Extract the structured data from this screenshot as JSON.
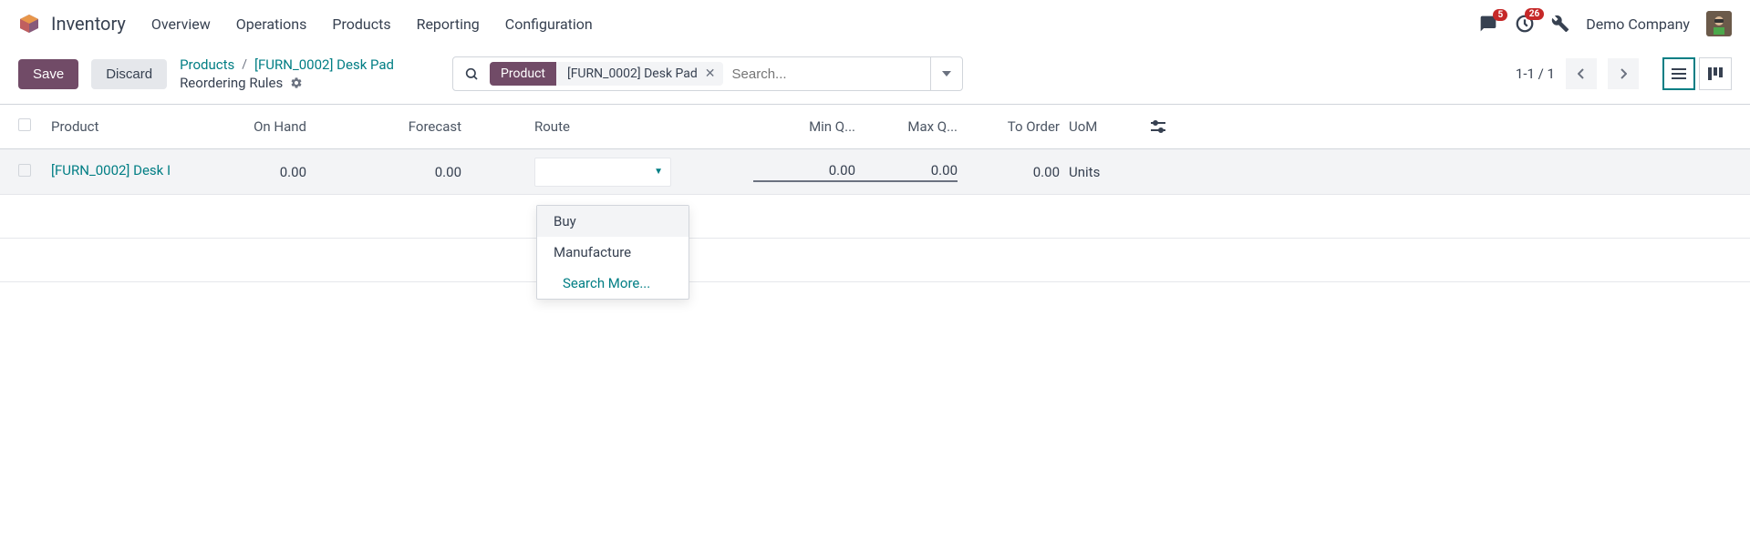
{
  "topnav": {
    "app_title": "Inventory",
    "items": [
      "Overview",
      "Operations",
      "Products",
      "Reporting",
      "Configuration"
    ],
    "msg_badge": "5",
    "activity_badge": "26",
    "company": "Demo Company"
  },
  "controls": {
    "save": "Save",
    "discard": "Discard",
    "breadcrumb": {
      "link1": "Products",
      "link2": "[FURN_0002] Desk Pad",
      "current": "Reordering Rules"
    },
    "search": {
      "tag_label": "Product",
      "tag_value": "[FURN_0002] Desk Pad",
      "placeholder": "Search..."
    },
    "pager": "1-1 / 1"
  },
  "table": {
    "headers": {
      "product": "Product",
      "onhand": "On Hand",
      "forecast": "Forecast",
      "route": "Route",
      "minq": "Min Q...",
      "maxq": "Max Q...",
      "toorder": "To Order",
      "uom": "UoM"
    },
    "row": {
      "product": "[FURN_0002] Desk I",
      "onhand": "0.00",
      "forecast": "0.00",
      "route": "",
      "minq": "0.00",
      "maxq": "0.00",
      "toorder": "0.00",
      "uom": "Units"
    }
  },
  "dropdown": {
    "opt1": "Buy",
    "opt2": "Manufacture",
    "more": "Search More..."
  }
}
